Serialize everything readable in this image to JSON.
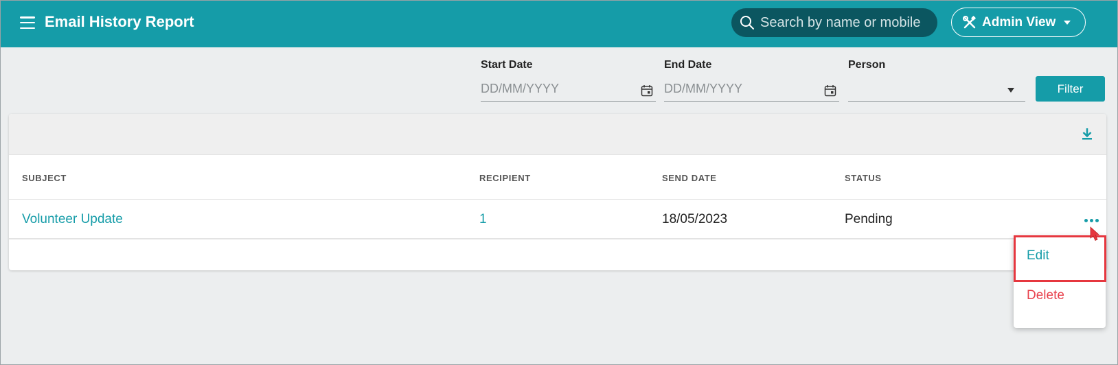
{
  "header": {
    "title": "Email History Report",
    "search_placeholder": "Search by name or mobile",
    "admin_view_label": "Admin View"
  },
  "filters": {
    "start_date": {
      "label": "Start Date",
      "placeholder": "DD/MM/YYYY",
      "value": ""
    },
    "end_date": {
      "label": "End Date",
      "placeholder": "DD/MM/YYYY",
      "value": ""
    },
    "person": {
      "label": "Person",
      "value": ""
    },
    "filter_button": "Filter"
  },
  "table": {
    "columns": [
      "SUBJECT",
      "RECIPIENT",
      "SEND DATE",
      "STATUS"
    ],
    "rows": [
      {
        "subject": "Volunteer Update",
        "recipient": "1",
        "send_date": "18/05/2023",
        "status": "Pending"
      }
    ]
  },
  "row_menu": {
    "items": [
      {
        "label": "Edit",
        "color": "#159ca8"
      },
      {
        "label": "Delete",
        "color": "#e8414c"
      }
    ]
  },
  "colors": {
    "accent": "#159ca8",
    "search_bg": "#0b5660",
    "danger": "#e8414c",
    "highlight": "#e6373f"
  },
  "icons": {
    "menu": "hamburger-icon",
    "search": "search-icon",
    "admin": "tools-icon",
    "calendar": "calendar-icon",
    "download": "download-icon",
    "more": "more-horizontal-icon"
  }
}
